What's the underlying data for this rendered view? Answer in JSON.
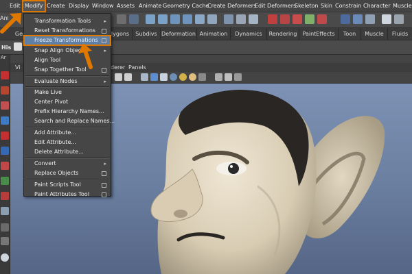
{
  "menubar": {
    "items": [
      "Edit",
      "Modify",
      "Create",
      "Display",
      "Window",
      "Assets",
      "Animate",
      "Geometry Cache",
      "Create Deformers",
      "Edit Deformers",
      "Skeleton",
      "Skin",
      "Constrain",
      "Character",
      "Muscle"
    ],
    "active_index": 1
  },
  "shelf": {
    "left_label": "Ani",
    "tabs": [
      "Gen",
      "lygons",
      "Subdivs",
      "Deformation",
      "Animation",
      "Dynamics",
      "Rendering",
      "PaintEffects",
      "Toon",
      "Muscle",
      "Fluids"
    ]
  },
  "left_panel": {
    "label_his": "His",
    "label_ar": "Ar",
    "label_vi": "Vi"
  },
  "panel_menu": {
    "items": [
      "derer",
      "Panels"
    ]
  },
  "modify_menu": {
    "items": [
      {
        "label": "Transformation Tools",
        "kind": "submenu"
      },
      {
        "label": "Reset Transformations",
        "kind": "option"
      },
      {
        "label": "Freeze Transformations",
        "kind": "option",
        "highlighted": true
      },
      {
        "label": "Snap Align Objects",
        "kind": "submenu"
      },
      {
        "label": "Align Tool",
        "kind": "none"
      },
      {
        "label": "Snap Together Tool",
        "kind": "option"
      },
      {
        "label": "Evaluate Nodes",
        "kind": "submenu"
      },
      {
        "label": "Make Live",
        "kind": "none"
      },
      {
        "label": "Center Pivot",
        "kind": "none"
      },
      {
        "label": "Prefix Hierarchy Names...",
        "kind": "none"
      },
      {
        "label": "Search and Replace Names...",
        "kind": "none"
      },
      {
        "label": "Add Attribute...",
        "kind": "none"
      },
      {
        "label": "Edit Attribute...",
        "kind": "none"
      },
      {
        "label": "Delete Attribute...",
        "kind": "none"
      },
      {
        "label": "Convert",
        "kind": "submenu"
      },
      {
        "label": "Replace Objects",
        "kind": "option"
      },
      {
        "label": "Paint Scripts Tool",
        "kind": "option"
      },
      {
        "label": "Paint Attributes Tool",
        "kind": "option"
      }
    ],
    "submenu_glyph": "▸"
  },
  "colors": {
    "accent_orange": "#e07800",
    "highlight_blue": "#5e7fa6",
    "viewport_top": "#7d92b4"
  },
  "icons": [
    "arrow-pointer-icon",
    "select-tool-icon",
    "move-tool-icon",
    "cube-icon",
    "sphere-icon",
    "cylinder-icon",
    "camera-icon",
    "light-icon"
  ]
}
